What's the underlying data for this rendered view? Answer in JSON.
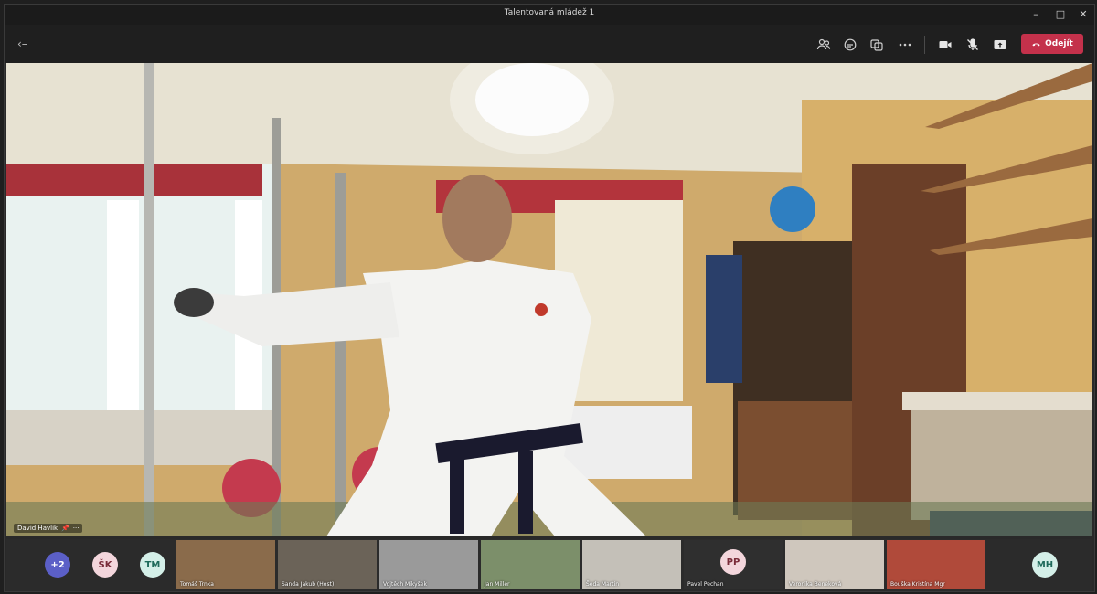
{
  "window": {
    "title": "Talentovaná mládež 1",
    "minimize": "–",
    "maximize": "□",
    "close": "✕"
  },
  "toolbar": {
    "back_label": "‹–",
    "leave_label": "Odejít",
    "icons": [
      "participants-icon",
      "chat-icon",
      "reactions-icon",
      "more-icon",
      "camera-icon",
      "mic-muted-icon",
      "share-icon",
      "leave-phone-icon"
    ]
  },
  "main_video": {
    "speaker_name": "David Havlík",
    "colors": {
      "wall": "#d7b070",
      "uniform": "#f1f1f1",
      "belt": "#1a1a2e"
    }
  },
  "participants": {
    "overflow_label": "+2",
    "avatars": [
      {
        "initials": "ŠK",
        "bg": "#f3d6dc",
        "fg": "#7a2c3a"
      },
      {
        "initials": "TM",
        "bg": "#d4efe8",
        "fg": "#1f6b5b"
      }
    ],
    "tiles": [
      {
        "name": "Tomáš Trnka",
        "bg": "#8a6b4b"
      },
      {
        "name": "Sanda Jakub (Host)",
        "bg": "#6b6358"
      },
      {
        "name": "Vojtěch Mikyšek",
        "bg": "#9a9a9a"
      },
      {
        "name": "Jan Miller",
        "bg": "#7c8f6a"
      },
      {
        "name": "Šeda Martin",
        "bg": "#c4c0b8"
      },
      {
        "name": "Pavel Pechan",
        "avatar": "PP",
        "bg": "#2f2f2f"
      },
      {
        "name": "Veronika Beneková",
        "bg": "#cfc7bd"
      },
      {
        "name": "Bouška Kristína Mgr",
        "bg": "#b04a3a"
      }
    ],
    "last_avatar": {
      "initials": "MH",
      "bg": "#d4efe8",
      "fg": "#1f6b5b"
    }
  }
}
